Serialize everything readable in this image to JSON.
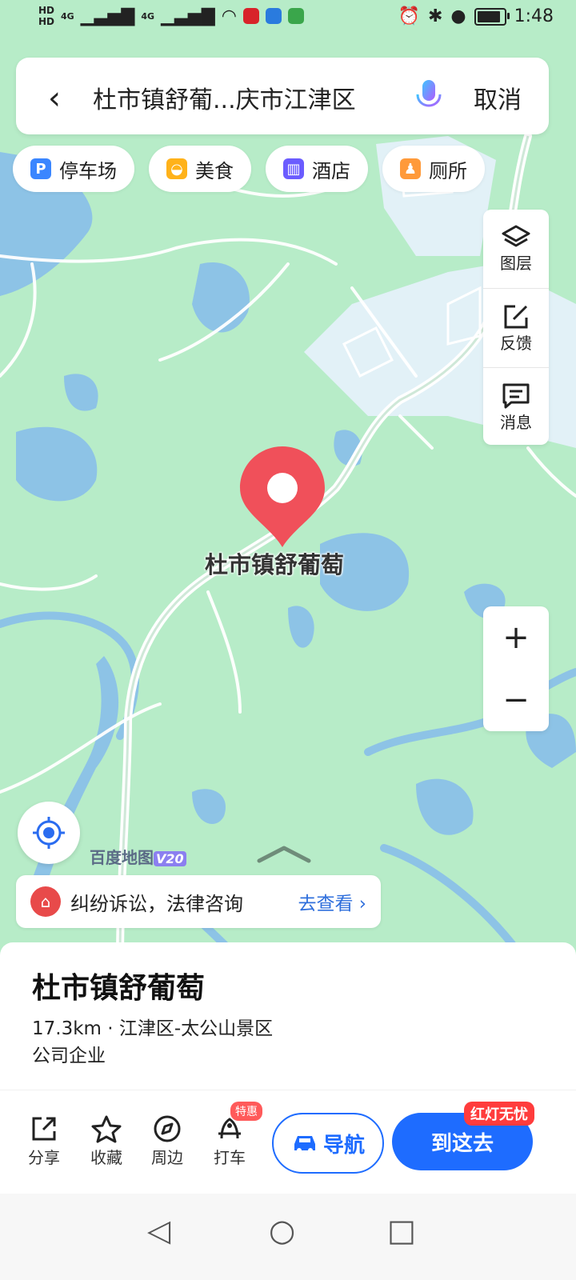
{
  "status_bar": {
    "time": "1:48",
    "network": [
      "4G",
      "4G"
    ],
    "hd": [
      "HD",
      "HD"
    ],
    "battery_level": 0.88
  },
  "search": {
    "query": "杜市镇舒葡...庆市江津区",
    "cancel_label": "取消"
  },
  "chips": [
    {
      "label": "停车场",
      "icon": "parking-icon",
      "color": "#3a86ff"
    },
    {
      "label": "美食",
      "icon": "food-icon",
      "color": "#ffb21a"
    },
    {
      "label": "酒店",
      "icon": "hotel-icon",
      "color": "#6b5cff"
    },
    {
      "label": "厕所",
      "icon": "toilet-icon",
      "color": "#ff9a3a"
    }
  ],
  "tools": [
    {
      "label": "图层",
      "icon": "layers-icon"
    },
    {
      "label": "反馈",
      "icon": "feedback-icon"
    },
    {
      "label": "消息",
      "icon": "message-icon"
    }
  ],
  "zoom": {
    "plus": "+",
    "minus": "−"
  },
  "map": {
    "pin_label": "杜市镇舒葡萄",
    "logo_text": "百度地图",
    "logo_version": "V20"
  },
  "promo": {
    "text": "纠纷诉讼，法律咨询",
    "link": "去查看 ›"
  },
  "place": {
    "title": "杜市镇舒葡萄",
    "meta": "17.3km · 江津区-太公山景区",
    "category": "公司企业"
  },
  "actions": [
    {
      "label": "分享",
      "icon": "share-icon"
    },
    {
      "label": "收藏",
      "icon": "star-icon"
    },
    {
      "label": "周边",
      "icon": "compass-icon"
    },
    {
      "label": "打车",
      "icon": "taxi-icon",
      "badge": "特惠"
    }
  ],
  "nav_button": "导航",
  "go_button": "到这去",
  "go_badge": "红灯无忧",
  "colors": {
    "accent": "#1e6cff",
    "pin": "#f0505a",
    "map_green": "#b7ecc8",
    "water": "#7fb6f0"
  }
}
